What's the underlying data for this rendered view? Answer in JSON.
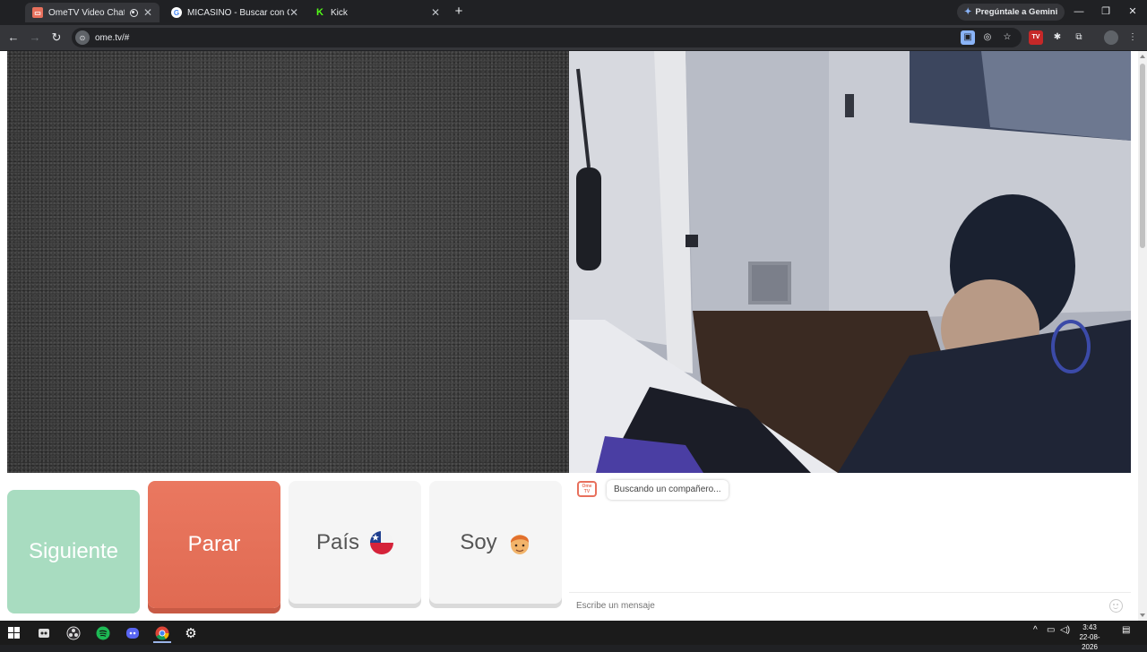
{
  "browser": {
    "tabs": [
      {
        "title": "OmeTV Video Chat — Ome",
        "favicon": "ometv-favicon",
        "active": true,
        "recording": true
      },
      {
        "title": "MICASINO - Buscar con Google",
        "favicon": "google-favicon",
        "active": false
      },
      {
        "title": "Kick",
        "favicon": "kick-favicon",
        "active": false
      }
    ],
    "new_tab": "+",
    "gemini_label": "Pregúntale a Gemini",
    "url": "ome.tv/#"
  },
  "buttons": {
    "next": "Siguiente",
    "stop": "Parar",
    "country": "País",
    "gender": "Soy"
  },
  "chat": {
    "logo_top": "Ome",
    "logo_bottom": "TV",
    "status_message": "Buscando un compañero...",
    "input_placeholder": "Escribe un mensaje"
  },
  "taskbar": {
    "time": "3:43",
    "date": "22-08-2026"
  },
  "colors": {
    "next_button": "#a8dcc0",
    "stop_button": "#e06a52",
    "neutral_button": "#f5f5f5",
    "chrome_dark": "#202124",
    "chrome_toolbar": "#35363a"
  }
}
